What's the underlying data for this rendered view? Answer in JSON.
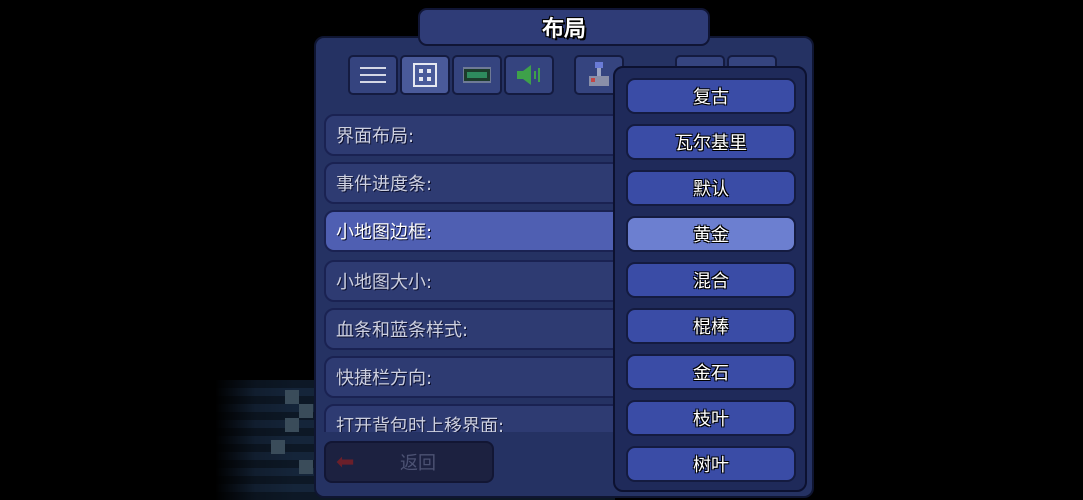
{
  "window": {
    "title": "布局"
  },
  "tabs": [
    {
      "icon": "hamburger-menu-icon"
    },
    {
      "icon": "interface-grid-icon"
    },
    {
      "icon": "video-screen-icon"
    },
    {
      "icon": "speaker-volume-icon"
    },
    {
      "icon": "gamepad-joystick-icon"
    }
  ],
  "settings": {
    "items": [
      {
        "label": "界面布局:"
      },
      {
        "label": "事件进度条:"
      },
      {
        "label": "小地图边框:"
      },
      {
        "label": "小地图大小:"
      },
      {
        "label": "血条和蓝条样式:"
      },
      {
        "label": "快捷栏方向:"
      },
      {
        "label": "打开背包时上移界面:"
      }
    ],
    "highlighted_index": 2
  },
  "back_button": {
    "label": "返回"
  },
  "dropdown": {
    "options": [
      "复古",
      "瓦尔基里",
      "默认",
      "黄金",
      "混合",
      "棍棒",
      "金石",
      "枝叶",
      "树叶"
    ],
    "selected": "黄金"
  },
  "colors": {
    "panel": "#253263",
    "highlight": "#4f5fb2",
    "option": "#3a4ca6",
    "option_selected": "#6c7fd0"
  }
}
